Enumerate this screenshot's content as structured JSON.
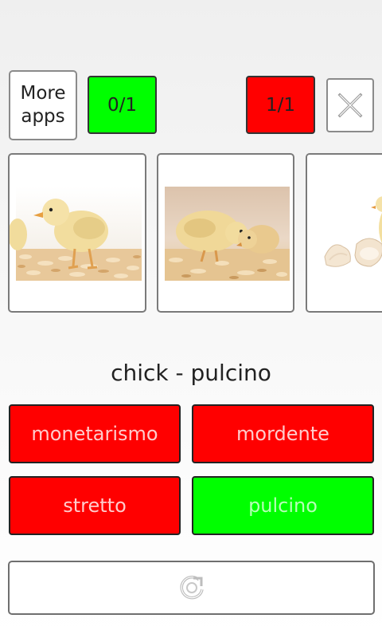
{
  "header": {
    "more_apps_label": "More\napps",
    "correct_score": "0/1",
    "wrong_score": "1/1",
    "close_icon": "close-icon"
  },
  "cards": [
    {
      "subject": "chick on wood shavings"
    },
    {
      "subject": "two chicks on wood shavings"
    },
    {
      "subject": "chick with egg shells"
    }
  ],
  "quiz": {
    "prompt": "chick - pulcino",
    "answers": [
      {
        "label": "monetarismo",
        "state": "wrong"
      },
      {
        "label": "mordente",
        "state": "wrong"
      },
      {
        "label": "stretto",
        "state": "wrong"
      },
      {
        "label": "pulcino",
        "state": "correct"
      }
    ]
  },
  "footer": {
    "reload_icon": "reload-icon"
  },
  "colors": {
    "correct": "#00ff00",
    "wrong": "#ff0000",
    "card_border": "#7a7a7a"
  }
}
